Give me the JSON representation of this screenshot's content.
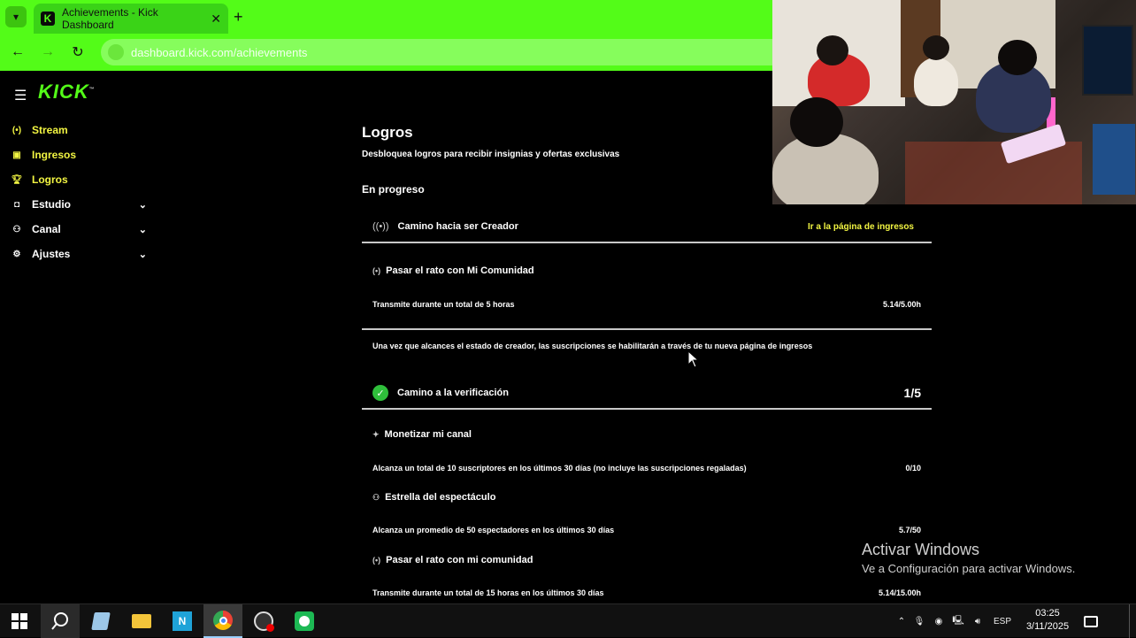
{
  "browser": {
    "tab_title": "Achievements - Kick Dashboard",
    "url": "dashboard.kick.com/achievements"
  },
  "sidebar": {
    "logo": "KICK",
    "items": [
      {
        "label": "Stream",
        "icon": "broadcast-icon",
        "color": "#f2f542"
      },
      {
        "label": "Ingresos",
        "icon": "wallet-icon",
        "color": "#f2f542"
      },
      {
        "label": "Logros",
        "icon": "trophy-icon",
        "color": "#f2f542"
      },
      {
        "label": "Estudio",
        "icon": "studio-icon"
      },
      {
        "label": "Canal",
        "icon": "channel-icon"
      },
      {
        "label": "Ajustes",
        "icon": "gear-icon"
      }
    ]
  },
  "main": {
    "title": "Logros",
    "subtitle": "Desbloquea logros para recibir insignias y ofertas exclusivas",
    "section_label": "En progreso",
    "creator": {
      "title": "Camino hacia ser Creador",
      "link": "Ir a la página de ingresos",
      "task_title": "Pasar el rato con Mi Comunidad",
      "task_desc": "Transmite durante un total de 5 horas",
      "task_value": "5.14/5.00h",
      "note": "Una vez que alcances el estado de creador, las suscripciones se habilitarán a través de tu nueva página de ingresos"
    },
    "verification": {
      "title": "Camino a la verificación",
      "count": "1/5",
      "tasks": [
        {
          "title": "Monetizar mi canal",
          "desc": "Alcanza un total de 10 suscriptores en los últimos 30 días (no incluye las suscripciones regaladas)",
          "value": "0/10"
        },
        {
          "title": "Estrella del espectáculo",
          "desc": "Alcanza un promedio de 50 espectadores en los últimos 30 días",
          "value": "5.7/50"
        },
        {
          "title": "Pasar el rato con mi comunidad",
          "desc": "Transmite durante un total de 15 horas en los últimos 30 días",
          "value": "5.14/15.00h"
        }
      ]
    }
  },
  "watermark": {
    "line1": "Activar Windows",
    "line2": "Ve a Configuración para activar Windows."
  },
  "taskbar": {
    "lang": "ESP",
    "time": "03:25",
    "date": "3/11/2025"
  },
  "colors": {
    "brand": "#53fc18",
    "accent_yellow": "#f2f542"
  }
}
